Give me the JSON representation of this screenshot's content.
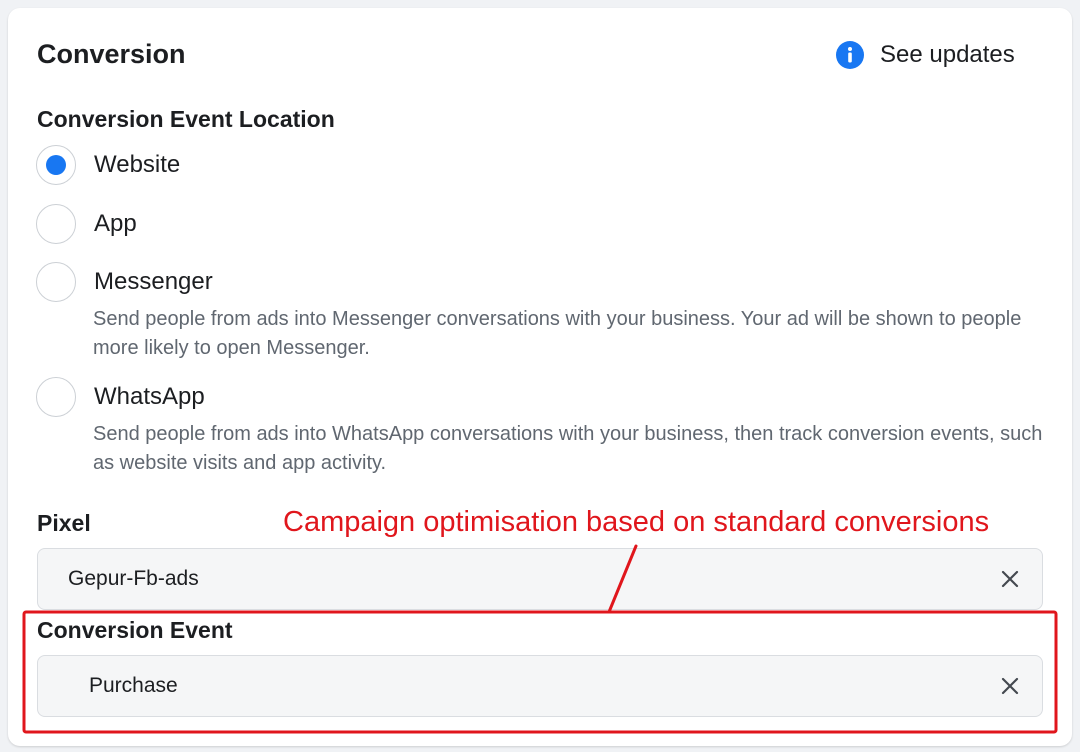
{
  "header": {
    "title": "Conversion",
    "updates_label": "See updates",
    "updates_icon": "info-icon"
  },
  "location": {
    "label": "Conversion Event Location",
    "selected": "Website",
    "options": [
      {
        "label": "Website",
        "checked": true
      },
      {
        "label": "App",
        "checked": false
      },
      {
        "label": "Messenger",
        "checked": false,
        "description": "Send people from ads into Messenger conversations with your business. Your ad will be shown to people more likely to open Messenger."
      },
      {
        "label": "WhatsApp",
        "checked": false,
        "description": "Send people from ads into WhatsApp conversations with your business, then track conversion events, such as website visits and app activity."
      }
    ]
  },
  "pixel": {
    "label": "Pixel",
    "value": "Gepur-Fb-ads",
    "clear_icon": "close-icon"
  },
  "conversion_event": {
    "label": "Conversion Event",
    "value": "Purchase",
    "clear_icon": "close-icon"
  },
  "annotation": {
    "text": "Campaign optimisation based on standard conversions",
    "color": "#e0161c"
  },
  "colors": {
    "accent": "#1877f2",
    "text": "#1c1e21",
    "secondary_text": "#606770",
    "field_bg": "#f5f6f7",
    "annotation": "#e0161c"
  }
}
